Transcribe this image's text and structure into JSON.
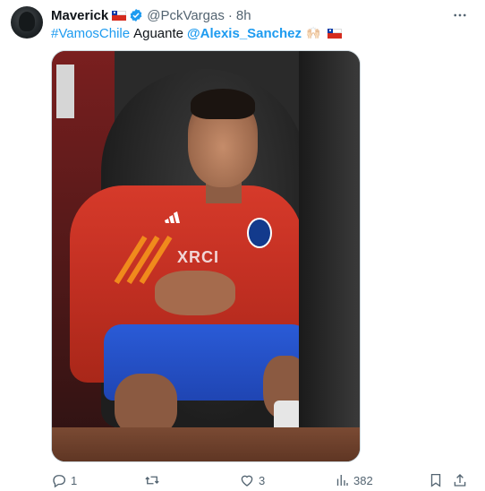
{
  "tweet": {
    "user": {
      "display_name": "Maverick",
      "handle": "@PckVargas",
      "separator": "·",
      "time": "8h"
    },
    "text": {
      "hashtag": "#VamosChile",
      "word": "Aguante",
      "mention": "@Alexis_Sanchez",
      "hands_emoji": "🙌🏻"
    },
    "media": {
      "sponsor_text": "XRCI"
    },
    "actions": {
      "replies": "1",
      "retweets": "",
      "likes": "3",
      "views": "382"
    },
    "colors": {
      "link": "#1d9bf0",
      "secondary_text": "#536471",
      "verified": "#1d9bf0"
    }
  }
}
